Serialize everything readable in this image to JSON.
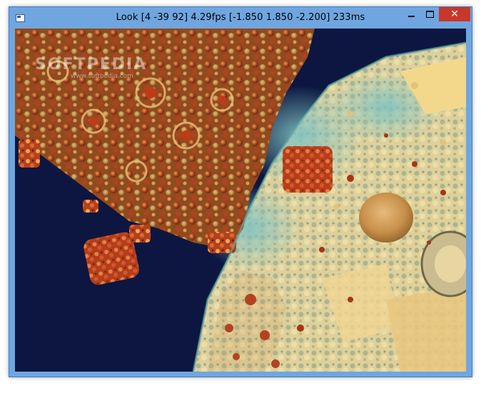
{
  "window": {
    "title": "Look [4 -39 92] 4.29fps [-1.850 1.850 -2.200] 233ms",
    "app_icon": "window-icon",
    "controls": {
      "minimize_icon": "minimize-icon",
      "maximize_icon": "maximize-icon",
      "close_icon": "close-icon",
      "close_glyph": "✕"
    },
    "accent_color": "#6fa6e0",
    "close_color": "#c7372b"
  },
  "render": {
    "description_icon": "fractal-render",
    "watermark": "SOFTPEDIA",
    "watermark_url": "www.softpedia.com"
  }
}
